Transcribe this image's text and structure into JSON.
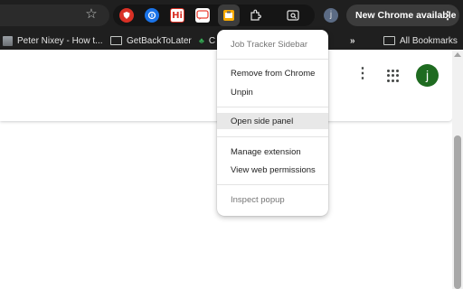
{
  "toolbar": {
    "update_chip_label": "New Chrome available",
    "profile_initial": "j",
    "extensions": [
      {
        "icon": "red-shield-icon",
        "color": "#d93025"
      },
      {
        "icon": "blue-circle-info-icon",
        "color": "#1a73e8"
      },
      {
        "icon": "hi-text-icon",
        "text": "Hi",
        "color": "#d93025"
      },
      {
        "icon": "chat-bubble-icon",
        "color": "#ea4335"
      },
      {
        "icon": "job-tracker-icon",
        "color": "#f9ab00"
      },
      {
        "icon": "puzzle-icon"
      },
      {
        "icon": "tab-search-icon"
      }
    ]
  },
  "bookmarks": {
    "items": [
      {
        "label": "Peter Nixey - How t..."
      },
      {
        "label": "GetBackToLater"
      },
      {
        "label": "C"
      }
    ],
    "overflow": "»",
    "all_bookmarks": "All Bookmarks"
  },
  "page": {
    "avatar_initial": "j"
  },
  "context_menu": {
    "title": "Job Tracker Sidebar",
    "remove": "Remove from Chrome",
    "unpin": "Unpin",
    "open_side_panel": "Open side panel",
    "manage": "Manage extension",
    "permissions": "View web permissions",
    "inspect": "Inspect popup"
  }
}
